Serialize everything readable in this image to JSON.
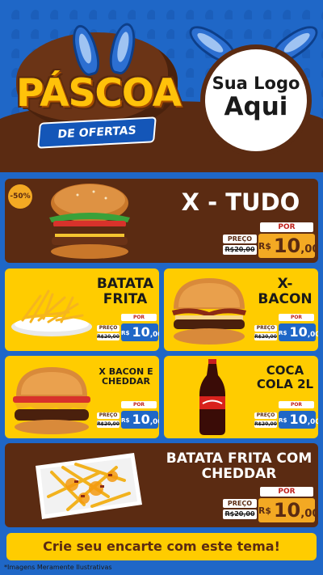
{
  "header": {
    "title": "PÁSCOA",
    "subtitle": "DE OFERTAS",
    "logo_line1": "Sua Logo",
    "logo_line2": "Aqui"
  },
  "badge": "-50%",
  "items": [
    {
      "name": "X - TUDO",
      "por": "POR",
      "preco": "PREÇO",
      "old_price": "R$20,00",
      "currency": "R$",
      "price_int": "10",
      "price_cents": ",00"
    },
    {
      "name": "BATATA FRITA",
      "por": "POR",
      "preco": "PREÇO",
      "old_price": "R$20,00",
      "currency": "R$",
      "price_int": "10",
      "price_cents": ",00"
    },
    {
      "name": "X- BACON",
      "por": "POR",
      "preco": "PREÇO",
      "old_price": "R$20,00",
      "currency": "R$",
      "price_int": "10",
      "price_cents": ",00"
    },
    {
      "name": "X BACON E CHEDDAR",
      "por": "POR",
      "preco": "PREÇO",
      "old_price": "R$20,00",
      "currency": "R$",
      "price_int": "10",
      "price_cents": ",00"
    },
    {
      "name": "COCA COLA 2L",
      "por": "POR",
      "preco": "PREÇO",
      "old_price": "R$20,00",
      "currency": "R$",
      "price_int": "10",
      "price_cents": ",00"
    },
    {
      "name": "BATATA FRITA COM CHEDDAR",
      "por": "POR",
      "preco": "PREÇO",
      "old_price": "R$20,00",
      "currency": "R$",
      "price_int": "10",
      "price_cents": ",00"
    }
  ],
  "cta": "Crie seu encarte com este tema!",
  "disclaimer": "*Imagens Meramente Ilustrativas",
  "colors": {
    "blue": "#1f67c7",
    "brown": "#5b2b12",
    "yellow": "#ffcc00",
    "orange": "#f3a923"
  }
}
